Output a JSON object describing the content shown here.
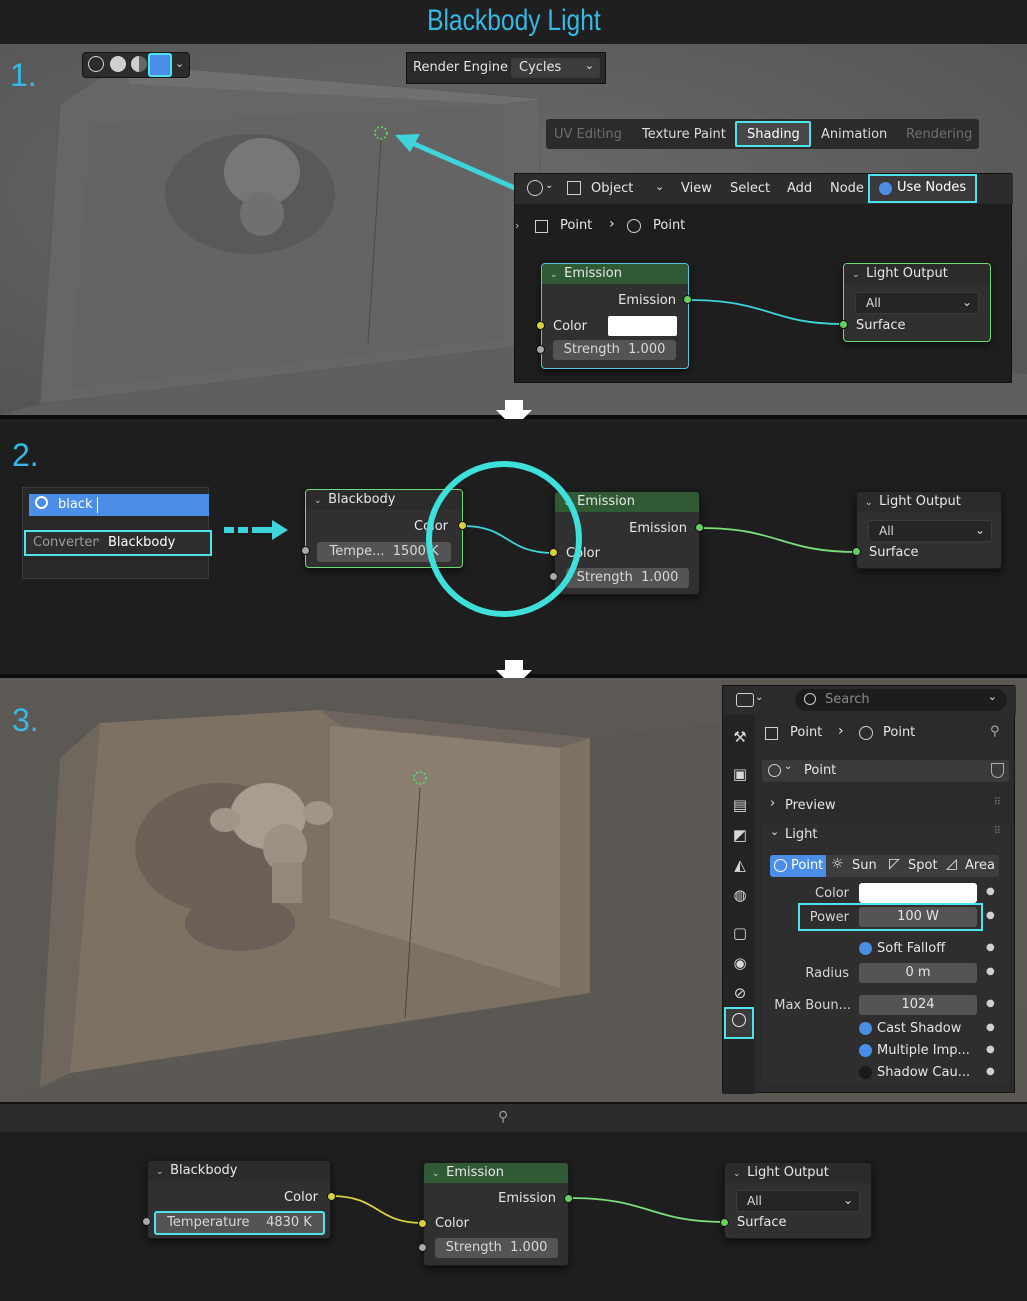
{
  "title": "Blackbody Light",
  "steps": {
    "one": "1.",
    "two": "2.",
    "three": "3."
  },
  "section1": {
    "render_engine": {
      "label": "Render Engine",
      "value": "Cycles"
    },
    "workspace_tabs": [
      "UV Editing",
      "Texture Paint",
      "Shading",
      "Animation",
      "Rendering"
    ],
    "active_tab": "Shading",
    "editor_header": {
      "object_mode": "Object",
      "menus": [
        "View",
        "Select",
        "Add",
        "Node"
      ],
      "use_nodes": "Use Nodes"
    },
    "breadcrumb": [
      "Point",
      "Point"
    ],
    "emission_node": {
      "title": "Emission",
      "output": "Emission",
      "color_label": "Color",
      "strength": "Strength",
      "strength_value": "1.000"
    },
    "light_output_node": {
      "title": "Light Output",
      "target": "All",
      "input": "Surface"
    }
  },
  "section2": {
    "search": {
      "query": "black",
      "result_category": "Converter",
      "result_name": "Blackbody"
    },
    "blackbody_node": {
      "title": "Blackbody",
      "output": "Color",
      "temp_label": "Tempe...",
      "temp_value": "1500 K"
    },
    "emission_node": {
      "title": "Emission",
      "output": "Emission",
      "color_label": "Color",
      "strength": "Strength",
      "strength_value": "1.000"
    },
    "light_output_node": {
      "title": "Light Output",
      "target": "All",
      "input": "Surface"
    }
  },
  "section3": {
    "search_placeholder": "Search",
    "breadcrumb": [
      "Point",
      "Point"
    ],
    "datablock": "Point",
    "panels": {
      "preview": "Preview",
      "light": "Light"
    },
    "light_types": [
      "Point",
      "Sun",
      "Spot",
      "Area"
    ],
    "active_type": "Point",
    "props": {
      "color_label": "Color",
      "power_label": "Power",
      "power_value": "100 W",
      "soft_falloff": "Soft Falloff",
      "radius_label": "Radius",
      "radius_value": "0 m",
      "max_bounces_label": "Max Boun...",
      "max_bounces_value": "1024",
      "cast_shadow": "Cast Shadow",
      "multiple_importance": "Multiple Imp...",
      "shadow_caustics": "Shadow Cau..."
    },
    "colors": {
      "accent": "#35b9e6",
      "highlight": "#4de3ea",
      "checkbox_on": "#4a8ee8"
    }
  },
  "section4": {
    "blackbody_node": {
      "title": "Blackbody",
      "output": "Color",
      "temp_label": "Temperature",
      "temp_value": "4830 K"
    },
    "emission_node": {
      "title": "Emission",
      "output": "Emission",
      "color_label": "Color",
      "strength": "Strength",
      "strength_value": "1.000"
    },
    "light_output_node": {
      "title": "Light Output",
      "target": "All",
      "input": "Surface"
    }
  }
}
